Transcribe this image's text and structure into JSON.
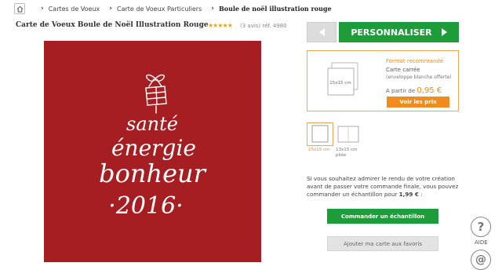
{
  "breadcrumb": {
    "items": [
      "Cartes de Voeux",
      "Carte de Voeux Particuliers"
    ],
    "current": "Boule de noël illustration rouge"
  },
  "product": {
    "title": "Carte de Voeux Boule de Noël Illustration Rouge",
    "rating": "★★★★★",
    "meta": "(3 avis)  réf. 4980"
  },
  "card": {
    "background": "#a51f22",
    "lines": [
      "santé",
      "énergie",
      "bonheur",
      "·2016·"
    ]
  },
  "actions": {
    "personnaliser": "PERSONNALISER"
  },
  "format": {
    "heading": "Format recommandé",
    "name": "Carte carrée",
    "note": "(enveloppe blanche offerte)",
    "thumb_label": "15x15 cm",
    "price_prefix": "A partir de",
    "price": "0,95 €",
    "prices_button": "Voir les prix",
    "options": [
      {
        "label": "15x15 cm"
      },
      {
        "label": "13x15 cm",
        "sub": "pliée"
      }
    ]
  },
  "sample": {
    "text": "Si vous souhaitez admirer le rendu de votre création avant de passer votre commande finale, vous pouvez commander un échantillon pour",
    "price": "1,99 €",
    "suffix": " :",
    "order_button": "Commander un échantillon",
    "favorite_button": "Ajouter ma carte aux favoris"
  },
  "help": {
    "aide_label": "AIDE",
    "aide_glyph": "?",
    "mail_glyph": "@"
  }
}
